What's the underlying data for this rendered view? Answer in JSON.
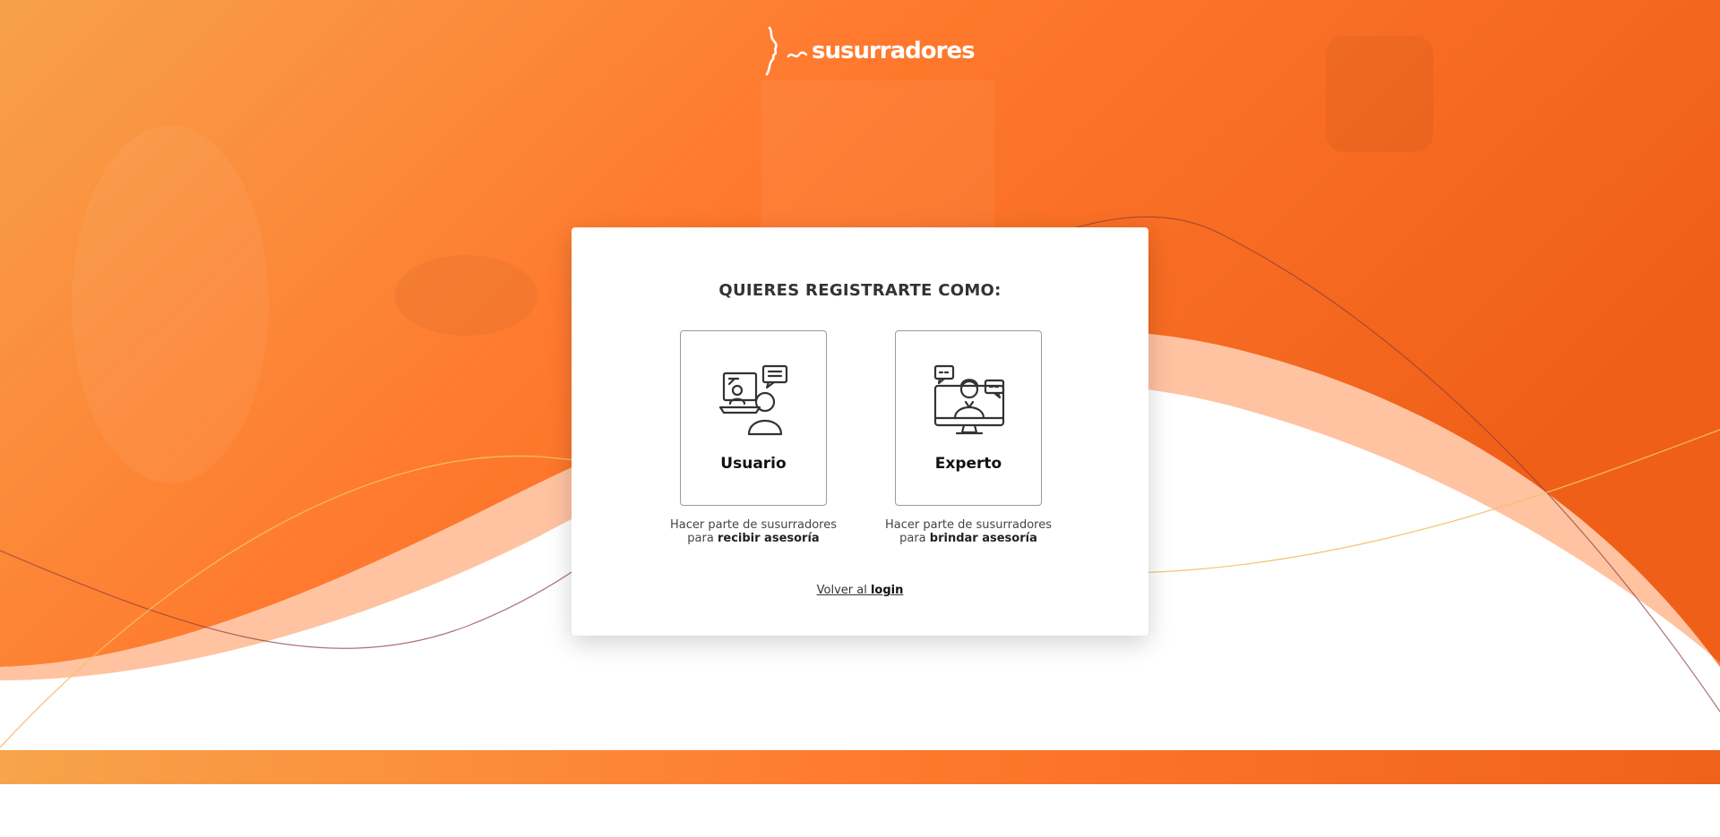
{
  "brand": {
    "name": "susurradores",
    "logo_icon": "face-profile-icon"
  },
  "colors": {
    "accent": "#f26a1f",
    "accent_light": "#ff8f50",
    "card": "#ffffff"
  },
  "registration": {
    "title": "QUIERES REGISTRARTE COMO:",
    "options": [
      {
        "label": "Usuario",
        "icon": "user-laptop-chat-icon",
        "desc_line1": "Hacer parte de susurradores",
        "desc_prefix": "para",
        "desc_bold": "recibir asesoría"
      },
      {
        "label": "Experto",
        "icon": "expert-monitor-chat-icon",
        "desc_line1": "Hacer parte de susurradores",
        "desc_prefix": "para",
        "desc_bold": "brindar asesoría"
      }
    ],
    "back_prefix": "Volver al",
    "back_link": "login"
  }
}
